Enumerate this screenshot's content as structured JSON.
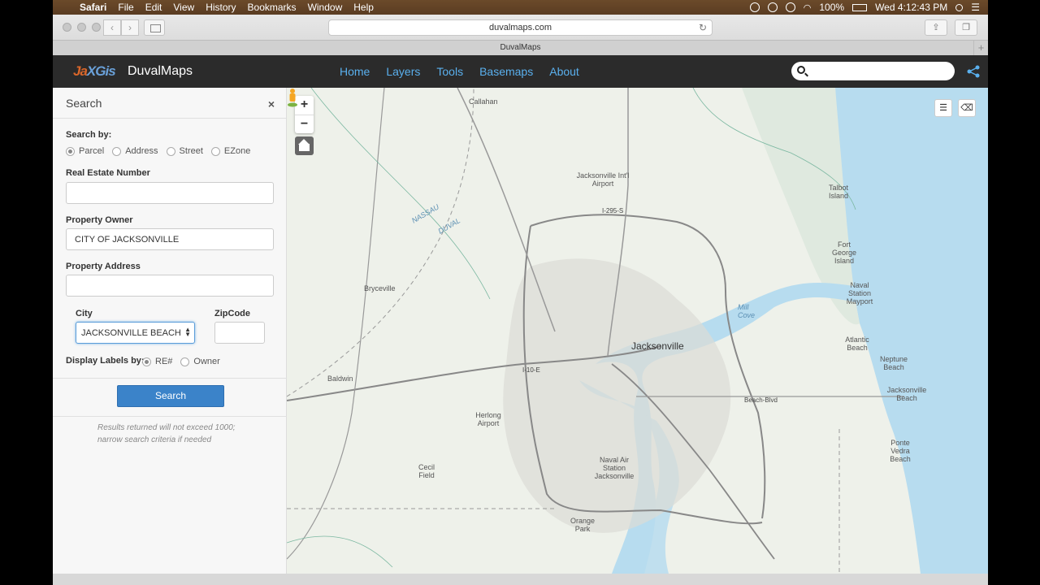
{
  "menubar": {
    "app": "Safari",
    "items": [
      "File",
      "Edit",
      "View",
      "History",
      "Bookmarks",
      "Window",
      "Help"
    ],
    "battery": "100%",
    "clock": "Wed 4:12:43 PM"
  },
  "browser": {
    "url": "duvalmaps.com",
    "tab_title": "DuvalMaps"
  },
  "app": {
    "logo_text_1": "Ja",
    "logo_text_2": "XGis",
    "name": "DuvalMaps",
    "nav": [
      "Home",
      "Layers",
      "Tools",
      "Basemaps",
      "About"
    ],
    "search_placeholder": ""
  },
  "panel": {
    "title": "Search",
    "close_glyph": "×",
    "search_by_label": "Search by:",
    "search_by_options": [
      "Parcel",
      "Address",
      "Street",
      "EZone"
    ],
    "search_by_selected": "Parcel",
    "re_number_label": "Real Estate Number",
    "re_number_value": "",
    "owner_label": "Property Owner",
    "owner_value": "CITY OF JACKSONVILLE",
    "address_label": "Property Address",
    "address_value": "",
    "city_label": "City",
    "city_value": "JACKSONVILLE BEACH",
    "zip_label": "ZipCode",
    "zip_value": "",
    "display_labels_label": "Display Labels by:",
    "display_labels_options": [
      "RE#",
      "Owner"
    ],
    "display_labels_selected": "RE#",
    "search_button": "Search",
    "note": "Results returned will not exceed 1000; narrow search criteria if needed"
  },
  "map": {
    "zoom_in": "+",
    "zoom_out": "−",
    "labels": {
      "callahan": "Callahan",
      "jax_airport": "Jacksonville Int'l Airport",
      "bryceville": "Bryceville",
      "baldwin": "Baldwin",
      "jacksonville": "Jacksonville",
      "herlong": "Herlong Airport",
      "cecil": "Cecil Field",
      "naval_air": "Naval Air Station Jacksonville",
      "orange_park": "Orange Park",
      "talbot": "Talbot Island",
      "fort_george": "Fort George Island",
      "naval_mayport": "Naval Station Mayport",
      "atlantic_beach": "Atlantic Beach",
      "neptune_beach": "Neptune Beach",
      "jax_beach": "Jacksonville Beach",
      "ponte_vedra": "Ponte Vedra Beach",
      "nassau": "NASSAU",
      "duval": "DUVAL",
      "mill_cove": "Mill Cove",
      "i295_n": "I-295-S",
      "i10": "I-10-E",
      "beach_blvd": "Beach-Blvd"
    }
  },
  "colors": {
    "menubar": "#5f4025",
    "app_header": "#2b2b2b",
    "nav_link": "#5ab0ee",
    "search_button": "#3b83c9",
    "map_land": "#eef1ea",
    "map_water": "#b7dcef",
    "ocean": "#aad6ee"
  }
}
